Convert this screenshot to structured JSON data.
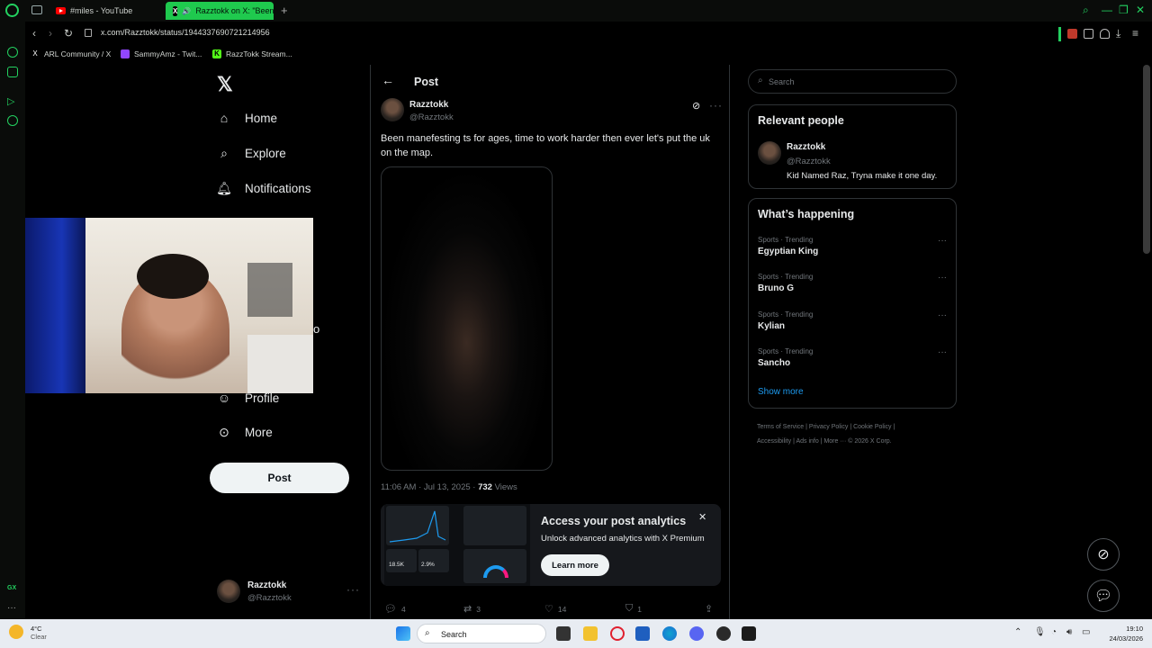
{
  "browser": {
    "tabs": [
      {
        "title": "#miles - YouTube"
      },
      {
        "title": "Razztokk on X: \"Been"
      }
    ],
    "url": "x.com/Razztokk/status/1944337690721214956",
    "bookmarks": [
      {
        "label": "ARL Community / X"
      },
      {
        "label": "SammyAmz - Twit..."
      },
      {
        "label": "RazzTokk Stream..."
      }
    ]
  },
  "sidebar": {
    "items": [
      {
        "label": "Home",
        "icon": "home-icon"
      },
      {
        "label": "Explore",
        "icon": "search-icon"
      },
      {
        "label": "Notifications",
        "icon": "bell-icon"
      },
      {
        "label": "Profile",
        "icon": "person-icon"
      },
      {
        "label": "More",
        "icon": "more-circle-icon"
      }
    ],
    "post_button": "Post",
    "account": {
      "name": "Razztokk",
      "handle": "@Razztokk"
    }
  },
  "post": {
    "header": "Post",
    "author_name": "Razztokk",
    "author_handle": "@Razztokk",
    "text": "Been manefesting ts for ages, time to work harder then ever let's put the uk on the map.",
    "time": "11:06 AM · Jul 13, 2025 · ",
    "views_count": "732",
    "views_label": " Views",
    "replies": "4",
    "reposts": "3",
    "likes": "14",
    "bookmarks": "1"
  },
  "promo": {
    "title": "Access your post analytics",
    "subtitle": "Unlock advanced analytics with X Premium",
    "button": "Learn more",
    "stat1": "18.5K",
    "stat2": "2.9%"
  },
  "right": {
    "search_placeholder": "Search",
    "relevant_title": "Relevant people",
    "person": {
      "name": "Razztokk",
      "handle": "@Razztokk",
      "bio": "Kid Named Raz, Tryna make it one day."
    },
    "happening_title": "What’s happening",
    "trends": [
      {
        "category": "Sports · Trending",
        "name": "Egyptian King"
      },
      {
        "category": "Sports · Trending",
        "name": "Bruno G"
      },
      {
        "category": "Sports · Trending",
        "name": "Kylian"
      },
      {
        "category": "Sports · Trending",
        "name": "Sancho"
      }
    ],
    "show_more": "Show more",
    "footer_line1": "Terms of Service  |   Privacy Policy  |   Cookie Policy  |",
    "footer_line2": "Accessibility  |   Ads info  |   More ···   © 2026 X Corp."
  },
  "taskbar": {
    "temp": "4°C",
    "condition": "Clear",
    "search_placeholder": "Search",
    "time": "19:10",
    "date": "24/03/2026"
  },
  "webcam_partial_text": "o",
  "colors": {
    "accent_green": "#23d160",
    "x_blue": "#1d9bf0",
    "background": "#000000"
  }
}
